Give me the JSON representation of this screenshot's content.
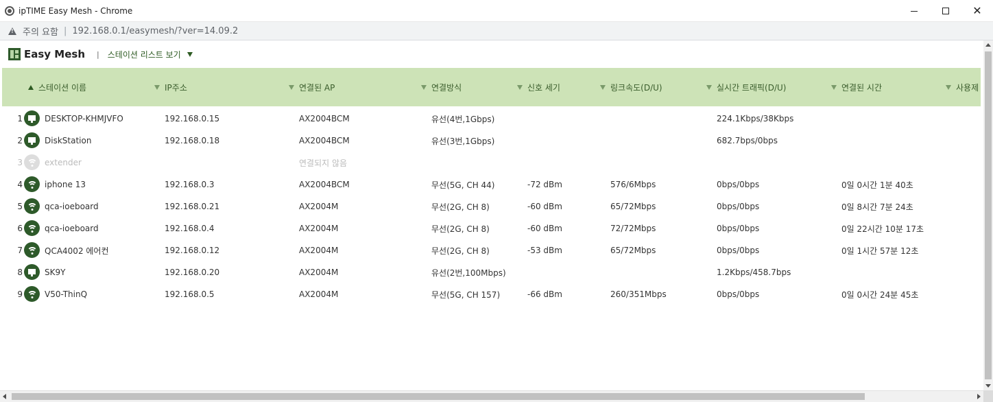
{
  "window": {
    "title": "ipTIME Easy Mesh - Chrome",
    "minimize_label": "minimize",
    "maximize_label": "maximize",
    "close_label": "close"
  },
  "address": {
    "security_text": "주의 요함",
    "separator": "|",
    "url": "192.168.0.1/easymesh/?ver=14.09.2"
  },
  "app": {
    "title": "Easy Mesh",
    "separator": "|",
    "view_menu_label": "스테이션 리스트 보기"
  },
  "colors": {
    "header_bg": "#cde3b7",
    "accent": "#2e5a2a",
    "text_disabled": "#bbbbbb"
  },
  "table": {
    "columns": [
      {
        "label": "스테이션 이름",
        "sort": "asc"
      },
      {
        "label": "IP주소",
        "sort": "none"
      },
      {
        "label": "연결된 AP",
        "sort": "none"
      },
      {
        "label": "연결방식",
        "sort": "none"
      },
      {
        "label": "신호 세기",
        "sort": "none"
      },
      {
        "label": "링크속도(D/U)",
        "sort": "none"
      },
      {
        "label": "실시간 트래픽(D/U)",
        "sort": "none"
      },
      {
        "label": "연결된 시간",
        "sort": "none"
      },
      {
        "label": "사용제",
        "sort": "none"
      }
    ],
    "rows": [
      {
        "num": "1",
        "icon": "desktop-icon",
        "name": "DESKTOP-KHMJVFO",
        "ip": "192.168.0.15",
        "ap": "AX2004BCM",
        "conn": "유선(4번,1Gbps)",
        "signal": "",
        "link": "",
        "traffic": "224.1Kbps/38Kbps",
        "time": "",
        "disabled": false
      },
      {
        "num": "2",
        "icon": "desktop-icon",
        "name": "DiskStation",
        "ip": "192.168.0.18",
        "ap": "AX2004BCM",
        "conn": "유선(3번,1Gbps)",
        "signal": "",
        "link": "",
        "traffic": "682.7bps/0bps",
        "time": "",
        "disabled": false
      },
      {
        "num": "3",
        "icon": "wifi-icon",
        "name": "extender",
        "ip": "",
        "ap": "연결되지 않음",
        "conn": "",
        "signal": "",
        "link": "",
        "traffic": "",
        "time": "",
        "disabled": true
      },
      {
        "num": "4",
        "icon": "wifi-icon",
        "name": "iphone 13",
        "ip": "192.168.0.3",
        "ap": "AX2004BCM",
        "conn": "무선(5G, CH 44)",
        "signal": "-72 dBm",
        "link": "576/6Mbps",
        "traffic": "0bps/0bps",
        "time": "0일 0시간 1분 40초",
        "disabled": false
      },
      {
        "num": "5",
        "icon": "wifi-icon",
        "name": "qca-ioeboard",
        "ip": "192.168.0.21",
        "ap": "AX2004M",
        "conn": "무선(2G, CH 8)",
        "signal": "-60 dBm",
        "link": "65/72Mbps",
        "traffic": "0bps/0bps",
        "time": "0일 8시간 7분 24초",
        "disabled": false
      },
      {
        "num": "6",
        "icon": "wifi-icon",
        "name": "qca-ioeboard",
        "ip": "192.168.0.4",
        "ap": "AX2004M",
        "conn": "무선(2G, CH 8)",
        "signal": "-60 dBm",
        "link": "72/72Mbps",
        "traffic": "0bps/0bps",
        "time": "0일 22시간 10분 17초",
        "disabled": false
      },
      {
        "num": "7",
        "icon": "wifi-icon",
        "name": "QCA4002 에어컨",
        "ip": "192.168.0.12",
        "ap": "AX2004M",
        "conn": "무선(2G, CH 8)",
        "signal": "-53 dBm",
        "link": "65/72Mbps",
        "traffic": "0bps/0bps",
        "time": "0일 1시간 57분 12초",
        "disabled": false
      },
      {
        "num": "8",
        "icon": "desktop-icon",
        "name": "SK9Y",
        "ip": "192.168.0.20",
        "ap": "AX2004M",
        "conn": "유선(2번,100Mbps)",
        "signal": "",
        "link": "",
        "traffic": "1.2Kbps/458.7bps",
        "time": "",
        "disabled": false
      },
      {
        "num": "9",
        "icon": "wifi-icon",
        "name": "V50-ThinQ",
        "ip": "192.168.0.5",
        "ap": "AX2004M",
        "conn": "무선(5G, CH 157)",
        "signal": "-66 dBm",
        "link": "260/351Mbps",
        "traffic": "0bps/0bps",
        "time": "0일 0시간 24분 45초",
        "disabled": false
      }
    ]
  }
}
